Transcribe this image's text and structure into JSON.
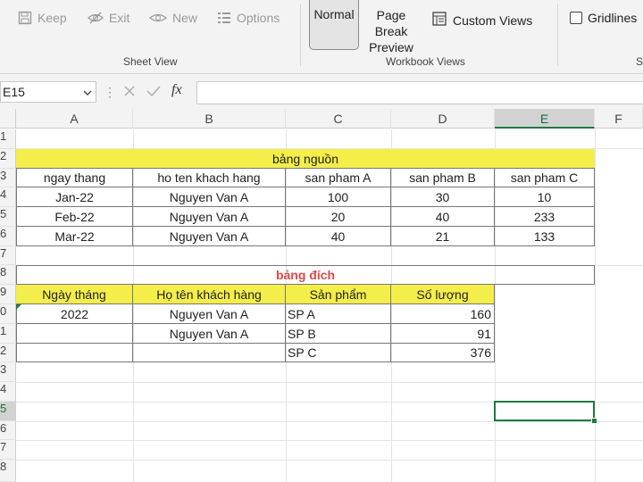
{
  "ribbon": {
    "sheet_view_items": [
      {
        "label": "Keep",
        "icon": "save-icon"
      },
      {
        "label": "Exit",
        "icon": "eye-slash-icon"
      },
      {
        "label": "New",
        "icon": "eye-icon"
      },
      {
        "label": "Options",
        "icon": "list-icon"
      }
    ],
    "sheet_view_group": "Sheet View",
    "normal_label": "Normal",
    "page_break_label": "Page Break Preview",
    "custom_views_label": "Custom Views",
    "workbook_views_group": "Workbook Views",
    "gridlines_label": "Gridlines",
    "show_group_partial": "S"
  },
  "formula_bar": {
    "name_box": "E15",
    "fx_label": "fx",
    "formula": ""
  },
  "columns": [
    "A",
    "B",
    "C",
    "D",
    "E",
    "F"
  ],
  "selected_column": "E",
  "rows": [
    "1",
    "2",
    "3",
    "4",
    "5",
    "6",
    "7",
    "8",
    "9",
    "0",
    "1",
    "2",
    "3",
    "4",
    "5",
    "6",
    "7",
    "8"
  ],
  "source_table": {
    "title": "bảng nguồn",
    "headers": [
      "ngay thang",
      "ho ten khach hang",
      "san pham A",
      "san pham B",
      "san pham C"
    ],
    "rows": [
      [
        "Jan-22",
        "Nguyen Van A",
        "100",
        "30",
        "10"
      ],
      [
        "Feb-22",
        "Nguyen Van A",
        "20",
        "40",
        "233"
      ],
      [
        "Mar-22",
        "Nguyen Van A",
        "40",
        "21",
        "133"
      ]
    ]
  },
  "dest_table": {
    "title": "bảng đích",
    "headers": [
      "Ngày tháng",
      "Họ tên khách hàng",
      "Sản phẩm",
      "Số lượng"
    ],
    "rows": [
      [
        "2022",
        "Nguyen Van A",
        "SP A",
        "160"
      ],
      [
        "",
        "Nguyen Van A",
        "SP B",
        "91"
      ],
      [
        "",
        "",
        "SP C",
        "376"
      ]
    ]
  },
  "colors": {
    "header_fill": "#f4ee4a",
    "dest_title": "#e04848",
    "selection": "#1e7a40"
  }
}
